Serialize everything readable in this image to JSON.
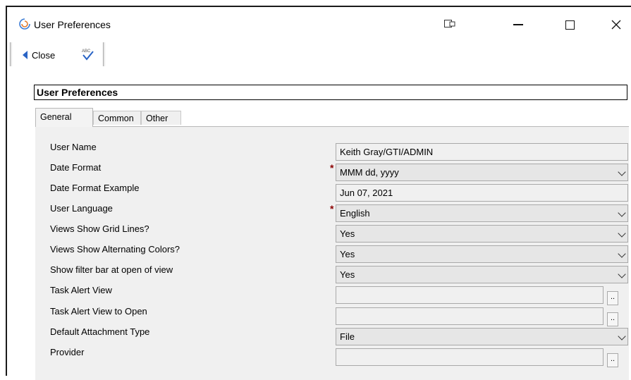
{
  "window": {
    "title": "User Preferences"
  },
  "toolbar": {
    "close_label": "Close"
  },
  "panel": {
    "title": "User Preferences"
  },
  "tabs": [
    {
      "label": "General",
      "active": true
    },
    {
      "label": "Common",
      "active": false
    },
    {
      "label": "Other",
      "active": false
    }
  ],
  "form": {
    "rows": [
      {
        "label": "User Name",
        "value": "Keith Gray/GTI/ADMIN",
        "kind": "readonly",
        "required": false
      },
      {
        "label": "Date Format",
        "value": "MMM dd, yyyy",
        "kind": "select",
        "required": true
      },
      {
        "label": "Date Format Example",
        "value": "Jun 07, 2021",
        "kind": "readonly",
        "required": false
      },
      {
        "label": "User Language",
        "value": "English",
        "kind": "select",
        "required": true
      },
      {
        "label": "Views Show Grid Lines?",
        "value": "Yes",
        "kind": "select",
        "required": false
      },
      {
        "label": "Views Show Alternating Colors?",
        "value": "Yes",
        "kind": "select",
        "required": false
      },
      {
        "label": "Show filter bar at open of view",
        "value": "Yes",
        "kind": "select",
        "required": false
      },
      {
        "label": "Task Alert View",
        "value": "",
        "kind": "lookup",
        "required": false
      },
      {
        "label": "Task Alert View to Open",
        "value": "",
        "kind": "lookup",
        "required": false
      },
      {
        "label": "Default Attachment Type",
        "value": "File",
        "kind": "select",
        "required": false
      },
      {
        "label": "Provider",
        "value": "",
        "kind": "lookup",
        "required": false
      }
    ],
    "required_marker": "*",
    "lookup_button": ".."
  },
  "colors": {
    "accent": "#2a64c5",
    "required": "#8b0000",
    "panel_bg": "#f0f0f0"
  }
}
